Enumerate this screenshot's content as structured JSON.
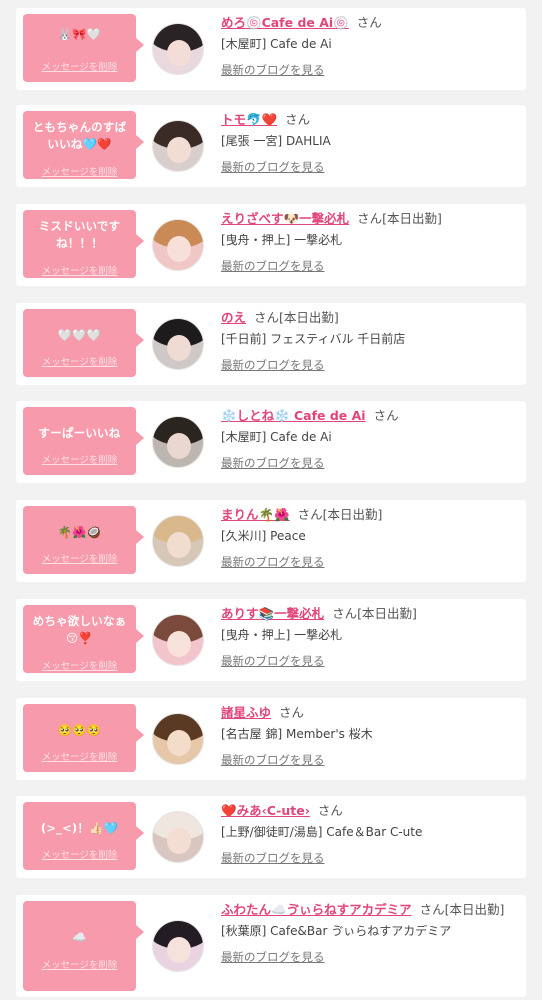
{
  "delete_label": "メッセージを削除",
  "san_label": "さん",
  "blog_label": "最新のブログを見る",
  "colors": {
    "accent_pink": "#f79aab",
    "name_pink": "#e2457a"
  },
  "items": [
    {
      "message": "🐰🎀🤍",
      "name": "めろ🍥Cafe de Ai🍥",
      "extra": "",
      "shop": "[木屋町] Cafe de Ai"
    },
    {
      "message": "ともちゃんのすばいいね🩵❤️",
      "name": "トモ🐬❤️",
      "extra": "",
      "shop": "[尾張 一宮] DAHLIA"
    },
    {
      "message": "ミスドいいですね！！！",
      "name": "えりざべす🐶一撃必札",
      "extra": "[本日出勤]",
      "shop": "[曳舟・押上] 一撃必札"
    },
    {
      "message": "🤍🤍🤍",
      "name": "のえ",
      "extra": "[本日出勤]",
      "shop": "[千日前] フェスティバル 千日前店"
    },
    {
      "message": "すーぱーいいね",
      "name": "❄️しとね❄️ Cafe de Ai",
      "extra": "",
      "shop": "[木屋町] Cafe de Ai"
    },
    {
      "message": "🌴🌺🥥",
      "name": "まりん🌴🌺",
      "extra": "[本日出勤]",
      "shop": "[久米川] Peace"
    },
    {
      "message": "めちゃ欲しいなぁ😚❣️",
      "name": "ありす📚一撃必札",
      "extra": "[本日出勤]",
      "shop": "[曳舟・押上] 一撃必札"
    },
    {
      "message": "🥺🥺🥺",
      "name": "諸星ふゆ",
      "extra": "",
      "shop": "[名古屋 錦] Member's 桜木"
    },
    {
      "message": "(>_<)！👍🏻🩵",
      "name": "❤️みあ‹C-ute›",
      "extra": "",
      "shop": "[上野/御徒町/湯島] Cafe＆Bar C-ute"
    },
    {
      "message": "☁️",
      "name": "ふわたん☁️ゔぃらねすアカデミア",
      "extra": "[本日出勤]",
      "shop": "[秋葉原] Cafe&Bar ゔぃらねすアカデミア"
    }
  ]
}
